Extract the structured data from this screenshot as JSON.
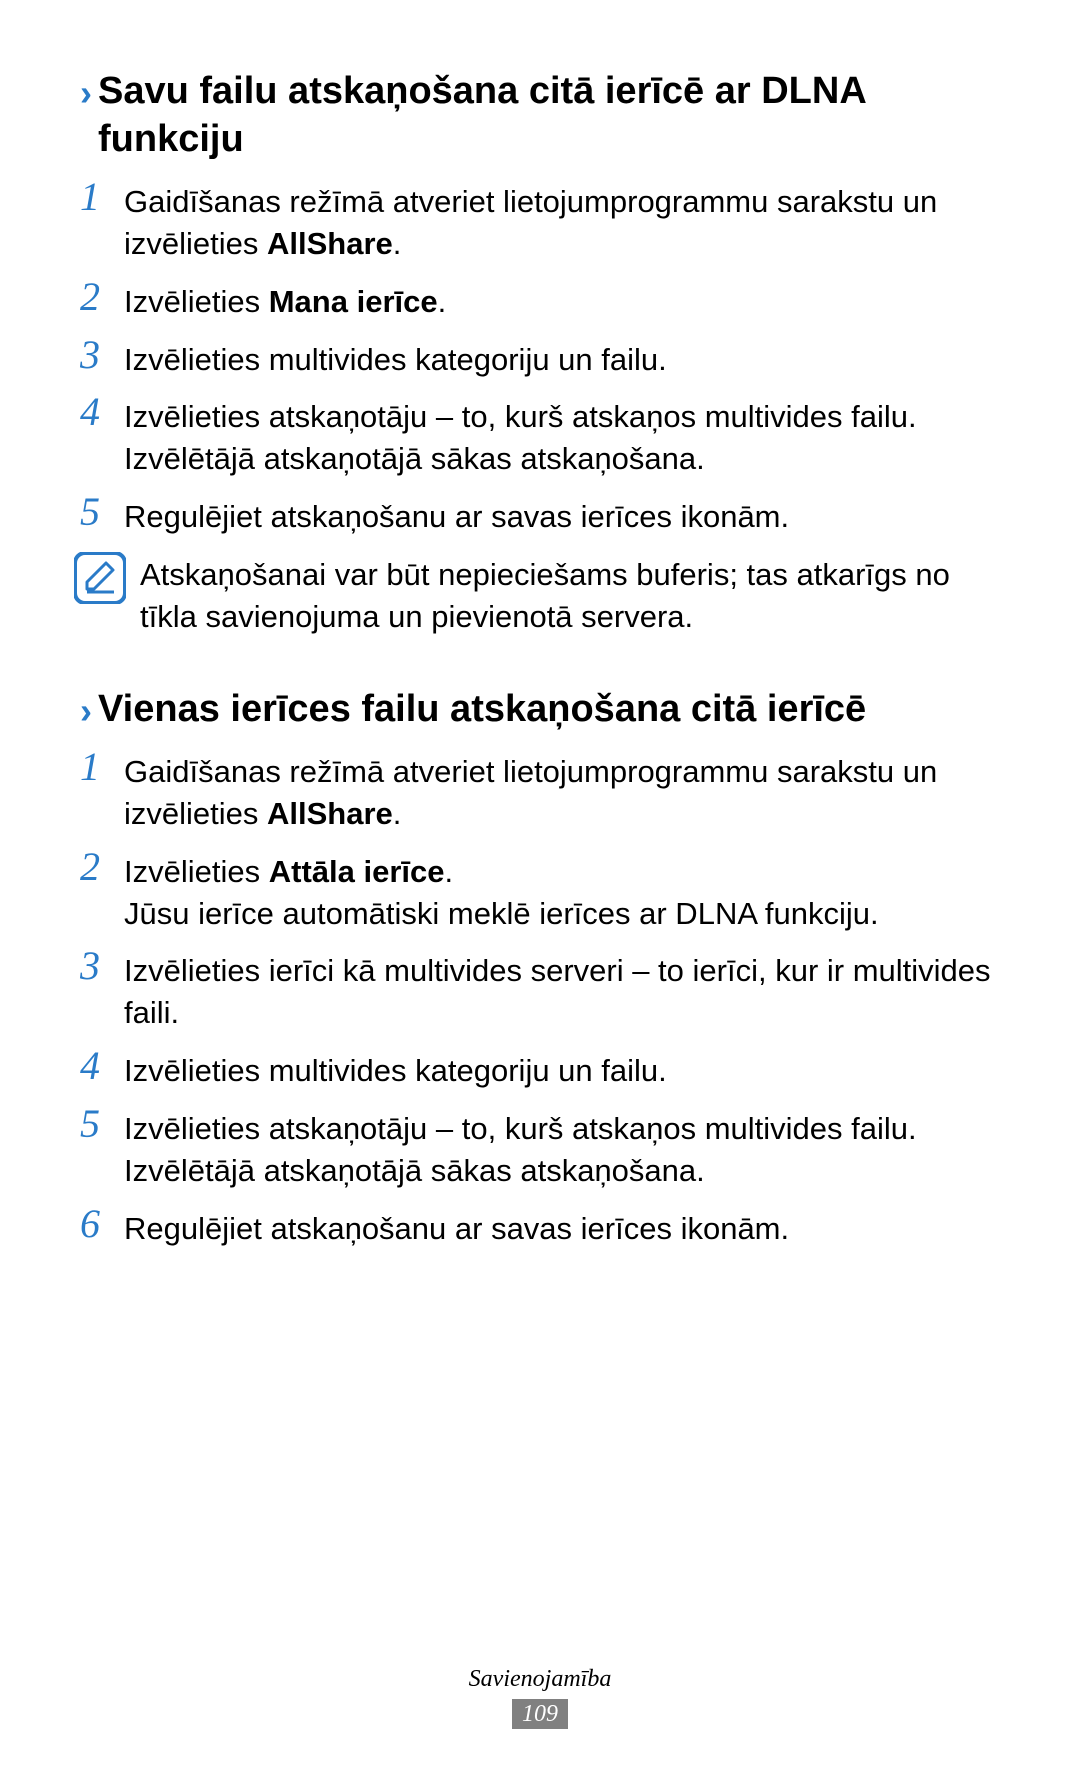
{
  "section1": {
    "heading": "Savu failu atskaņošana citā ierīcē ar DLNA funkciju",
    "steps": [
      {
        "num": "1",
        "pre": "Gaidīšanas režīmā atveriet lietojumprogrammu sarakstu un izvēlieties ",
        "bold": "AllShare",
        "post": "."
      },
      {
        "num": "2",
        "pre": "Izvēlieties ",
        "bold": "Mana ierīce",
        "post": "."
      },
      {
        "num": "3",
        "pre": "Izvēlieties multivides kategoriju un failu.",
        "bold": "",
        "post": ""
      },
      {
        "num": "4",
        "pre": "Izvēlieties atskaņotāju – to, kurš atskaņos multivides failu.",
        "bold": "",
        "post": "",
        "line2": "Izvēlētājā atskaņotājā sākas atskaņošana."
      },
      {
        "num": "5",
        "pre": "Regulējiet atskaņošanu ar savas ierīces ikonām.",
        "bold": "",
        "post": ""
      }
    ],
    "note": "Atskaņošanai var būt nepieciešams buferis; tas atkarīgs no tīkla savienojuma un pievienotā servera."
  },
  "section2": {
    "heading": "Vienas ierīces failu atskaņošana citā ierīcē",
    "steps": [
      {
        "num": "1",
        "pre": "Gaidīšanas režīmā atveriet lietojumprogrammu sarakstu un izvēlieties ",
        "bold": "AllShare",
        "post": "."
      },
      {
        "num": "2",
        "pre": "Izvēlieties ",
        "bold": "Attāla ierīce",
        "post": ".",
        "line2": "Jūsu ierīce automātiski meklē ierīces ar DLNA funkciju."
      },
      {
        "num": "3",
        "pre": "Izvēlieties ierīci kā multivides serveri – to ierīci, kur ir multivides faili.",
        "bold": "",
        "post": ""
      },
      {
        "num": "4",
        "pre": "Izvēlieties multivides kategoriju un failu.",
        "bold": "",
        "post": ""
      },
      {
        "num": "5",
        "pre": "Izvēlieties atskaņotāju – to, kurš atskaņos multivides failu.",
        "bold": "",
        "post": "",
        "line2": "Izvēlētājā atskaņotājā sākas atskaņošana."
      },
      {
        "num": "6",
        "pre": "Regulējiet atskaņošanu ar savas ierīces ikonām.",
        "bold": "",
        "post": ""
      }
    ]
  },
  "footer": {
    "label": "Savienojamība",
    "page": "109"
  }
}
